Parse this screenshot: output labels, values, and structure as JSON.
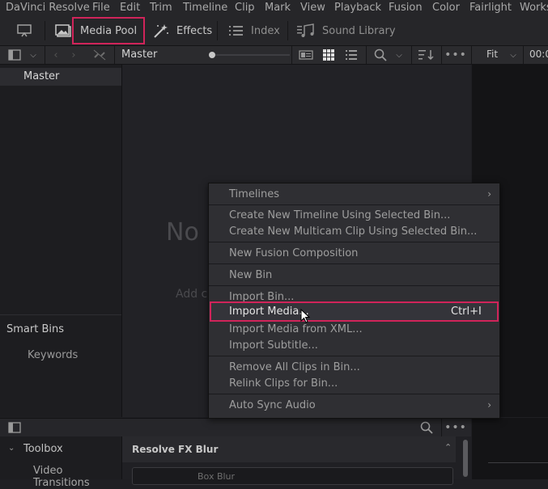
{
  "menubar": {
    "items": [
      "DaVinci Resolve",
      "File",
      "Edit",
      "Trim",
      "Timeline",
      "Clip",
      "Mark",
      "View",
      "Playback",
      "Fusion",
      "Color",
      "Fairlight",
      "Works"
    ]
  },
  "toolbar": {
    "media_pool": "Media Pool",
    "effects": "Effects",
    "index": "Index",
    "sound_library": "Sound Library"
  },
  "subbar": {
    "bin_title": "Master",
    "fit_label": "Fit",
    "timecode": "00:0"
  },
  "bins": {
    "master": "Master",
    "smart_bins": "Smart Bins",
    "keywords": "Keywords"
  },
  "pool": {
    "empty_title": "No c",
    "empty_hint": "Add c"
  },
  "context_menu": {
    "timelines": "Timelines",
    "create_timeline": "Create New Timeline Using Selected Bin...",
    "create_multicam": "Create New Multicam Clip Using Selected Bin...",
    "new_fusion": "New Fusion Composition",
    "new_bin": "New Bin",
    "import_bin": "Import Bin...",
    "import_media": "Import Media...",
    "import_media_shortcut": "Ctrl+I",
    "import_xml": "Import Media from XML...",
    "import_subtitle": "Import Subtitle...",
    "remove_clips": "Remove All Clips in Bin...",
    "relink_clips": "Relink Clips for Bin...",
    "auto_sync": "Auto Sync Audio"
  },
  "toolbox": {
    "title": "Toolbox",
    "video_transitions": "Video Transitions"
  },
  "fx": {
    "group_title": "Resolve FX Blur",
    "first_item": "Box Blur"
  },
  "colors": {
    "highlight": "#d0245a",
    "background": "#1f1f23"
  }
}
